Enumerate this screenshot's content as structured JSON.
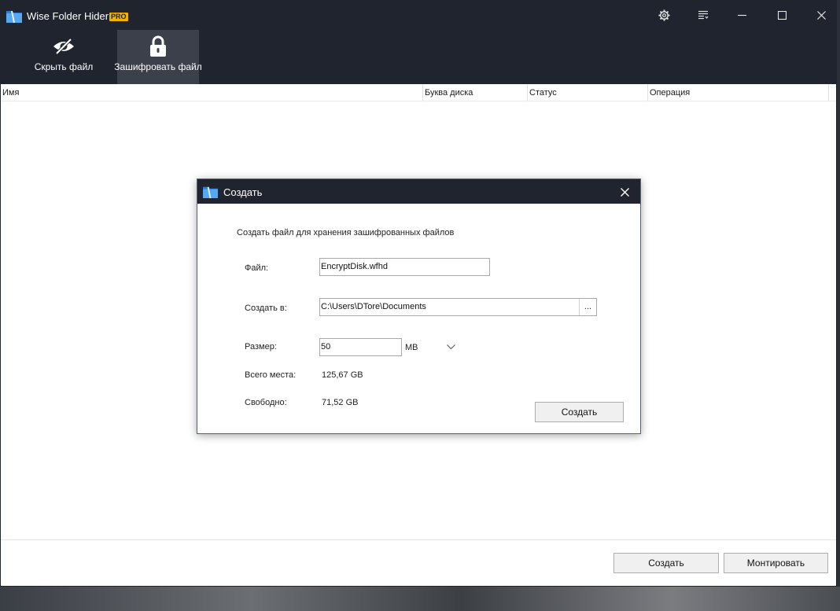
{
  "window": {
    "title": "Wise Folder Hider",
    "badge": "PRO",
    "accent": "#1f242e"
  },
  "toolbar": {
    "hide_file": "Скрыть файл",
    "encrypt_file": "Зашифровать файл"
  },
  "table": {
    "columns": [
      "Имя",
      "Буква диска",
      "Статус",
      "Операция"
    ]
  },
  "footer": {
    "create_label": "Создать",
    "mount_label": "Монтировать"
  },
  "dialog": {
    "title": "Создать",
    "description": "Создать файл для хранения зашифрованных файлов",
    "file_label": "Файл:",
    "file_value": "EncryptDisk.wfhd",
    "create_in_label": "Создать в:",
    "create_in_value": "C:\\Users\\DTore\\Documents",
    "browse_label": "...",
    "size_label": "Размер:",
    "size_value": "50",
    "size_unit": "MB",
    "total_label": "Всего места:",
    "total_value": "125,67 GB",
    "free_label": "Свободно:",
    "free_value": "71,52 GB",
    "create_button": "Создать"
  },
  "icons": {
    "settings": "gear-icon",
    "menu": "menu-icon",
    "minimize": "minimize-icon",
    "maximize": "maximize-icon",
    "close": "close-icon",
    "hide": "eye-slash-icon",
    "lock": "lock-icon",
    "dropdown": "chevron-down-icon"
  }
}
